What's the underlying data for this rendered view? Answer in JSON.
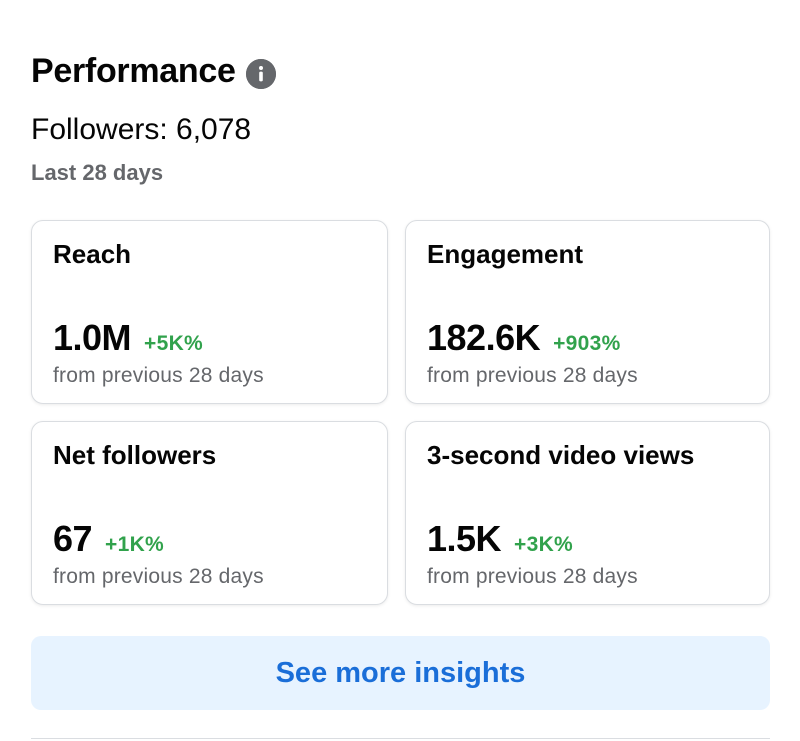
{
  "header": {
    "title": "Performance",
    "info_icon": "info-icon"
  },
  "summary": {
    "followers": "Followers: 6,078",
    "period": "Last 28 days"
  },
  "cards": [
    {
      "label": "Reach",
      "value": "1.0M",
      "change": "+5K%",
      "sub": "from previous 28 days"
    },
    {
      "label": "Engagement",
      "value": "182.6K",
      "change": "+903%",
      "sub": "from previous 28 days"
    },
    {
      "label": "Net followers",
      "value": "67",
      "change": "+1K%",
      "sub": "from previous 28 days"
    },
    {
      "label": "3-second video views",
      "value": "1.5K",
      "change": "+3K%",
      "sub": "from previous 28 days"
    }
  ],
  "cta": {
    "label": "See more insights"
  },
  "colors": {
    "positive": "#31a24c",
    "link": "#1a6ed8",
    "cta_background": "#e7f3ff",
    "secondary_text": "#65676b"
  }
}
